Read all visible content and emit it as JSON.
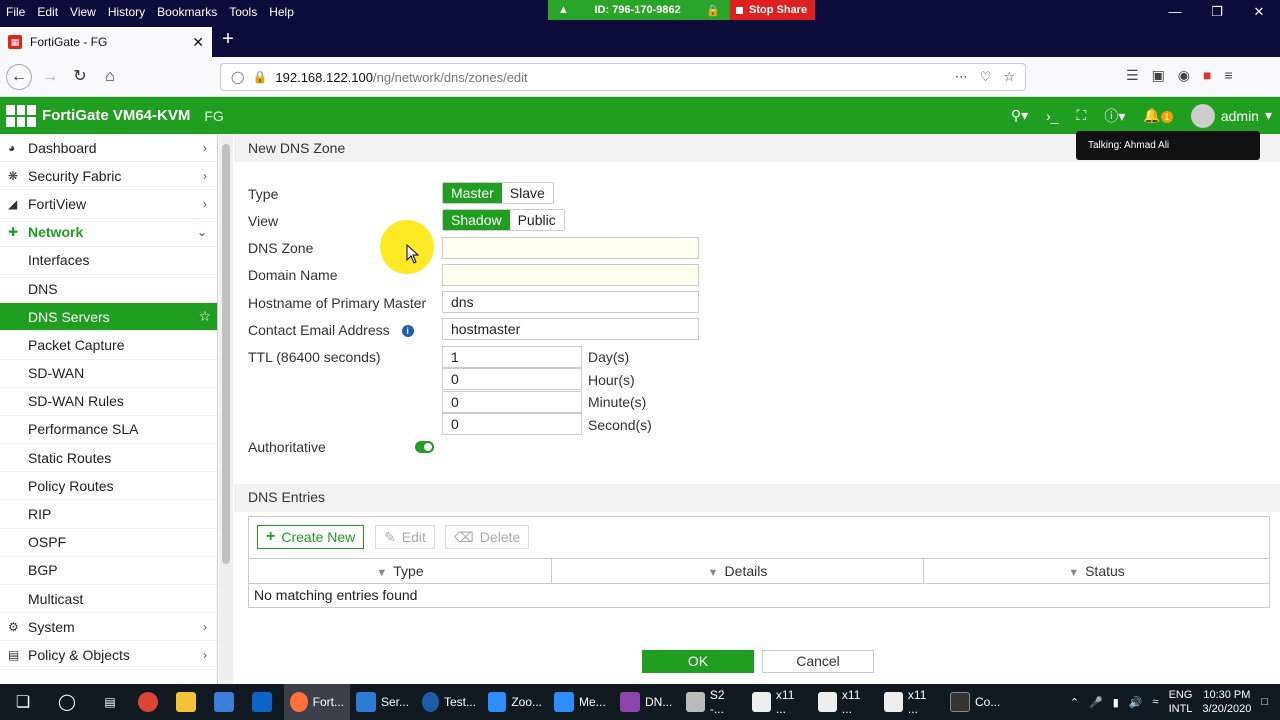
{
  "browser": {
    "menu": [
      "File",
      "Edit",
      "View",
      "History",
      "Bookmarks",
      "Tools",
      "Help"
    ],
    "zoom_meeting_id": "ID: 796-170-9862",
    "stop_share": "Stop Share",
    "tab_title": "FortiGate - FG",
    "url_host": "192.168.122.100",
    "url_path": "/ng/network/dns/zones/edit"
  },
  "header": {
    "product": "FortiGate VM64-KVM",
    "hostname": "FG",
    "notif_count": "1",
    "user": "admin",
    "tooltip": "Talking: Ahmad Ali"
  },
  "sidebar": {
    "items": [
      {
        "label": "Dashboard",
        "icon": "dashboard-icon"
      },
      {
        "label": "Security Fabric",
        "icon": "security-fabric-icon"
      },
      {
        "label": "FortiView",
        "icon": "fortiview-icon"
      },
      {
        "label": "Network",
        "icon": "network-icon"
      },
      {
        "label": "Interfaces"
      },
      {
        "label": "DNS"
      },
      {
        "label": "DNS Servers"
      },
      {
        "label": "Packet Capture"
      },
      {
        "label": "SD-WAN"
      },
      {
        "label": "SD-WAN Rules"
      },
      {
        "label": "Performance SLA"
      },
      {
        "label": "Static Routes"
      },
      {
        "label": "Policy Routes"
      },
      {
        "label": "RIP"
      },
      {
        "label": "OSPF"
      },
      {
        "label": "BGP"
      },
      {
        "label": "Multicast"
      },
      {
        "label": "System",
        "icon": "system-icon"
      },
      {
        "label": "Policy & Objects",
        "icon": "policy-objects-icon"
      }
    ]
  },
  "form": {
    "page_title": "New DNS Zone",
    "type_label": "Type",
    "type_options": [
      "Master",
      "Slave"
    ],
    "type_selected": "Master",
    "view_label": "View",
    "view_options": [
      "Shadow",
      "Public"
    ],
    "view_selected": "Shadow",
    "dns_zone_label": "DNS Zone",
    "dns_zone_value": "",
    "domain_name_label": "Domain Name",
    "domain_name_value": "",
    "hostname_label": "Hostname of Primary Master",
    "hostname_value": "dns",
    "email_label": "Contact Email Address",
    "email_value": "hostmaster",
    "ttl_label": "TTL (86400 seconds)",
    "ttl_days": "1",
    "ttl_hours": "0",
    "ttl_minutes": "0",
    "ttl_seconds": "0",
    "unit_days": "Day(s)",
    "unit_hours": "Hour(s)",
    "unit_minutes": "Minute(s)",
    "unit_seconds": "Second(s)",
    "authoritative_label": "Authoritative",
    "authoritative_on": true
  },
  "entries": {
    "section_title": "DNS Entries",
    "create_label": "Create New",
    "edit_label": "Edit",
    "delete_label": "Delete",
    "columns": [
      "Type",
      "Details",
      "Status"
    ],
    "empty_text": "No matching entries found"
  },
  "actions": {
    "ok": "OK",
    "cancel": "Cancel"
  },
  "taskbar": {
    "apps": [
      "Fort...",
      "Ser...",
      "Test...",
      "Zoo...",
      "Me...",
      "DN...",
      "S2 -...",
      "x11 ...",
      "x11 ...",
      "x11 ...",
      "Co..."
    ],
    "lang": "ENG",
    "layout": "INTL",
    "time": "10:30 PM",
    "date": "3/20/2020"
  },
  "colors": {
    "brand_green": "#1f9e1f",
    "browser_dark": "#0c0c3a"
  }
}
